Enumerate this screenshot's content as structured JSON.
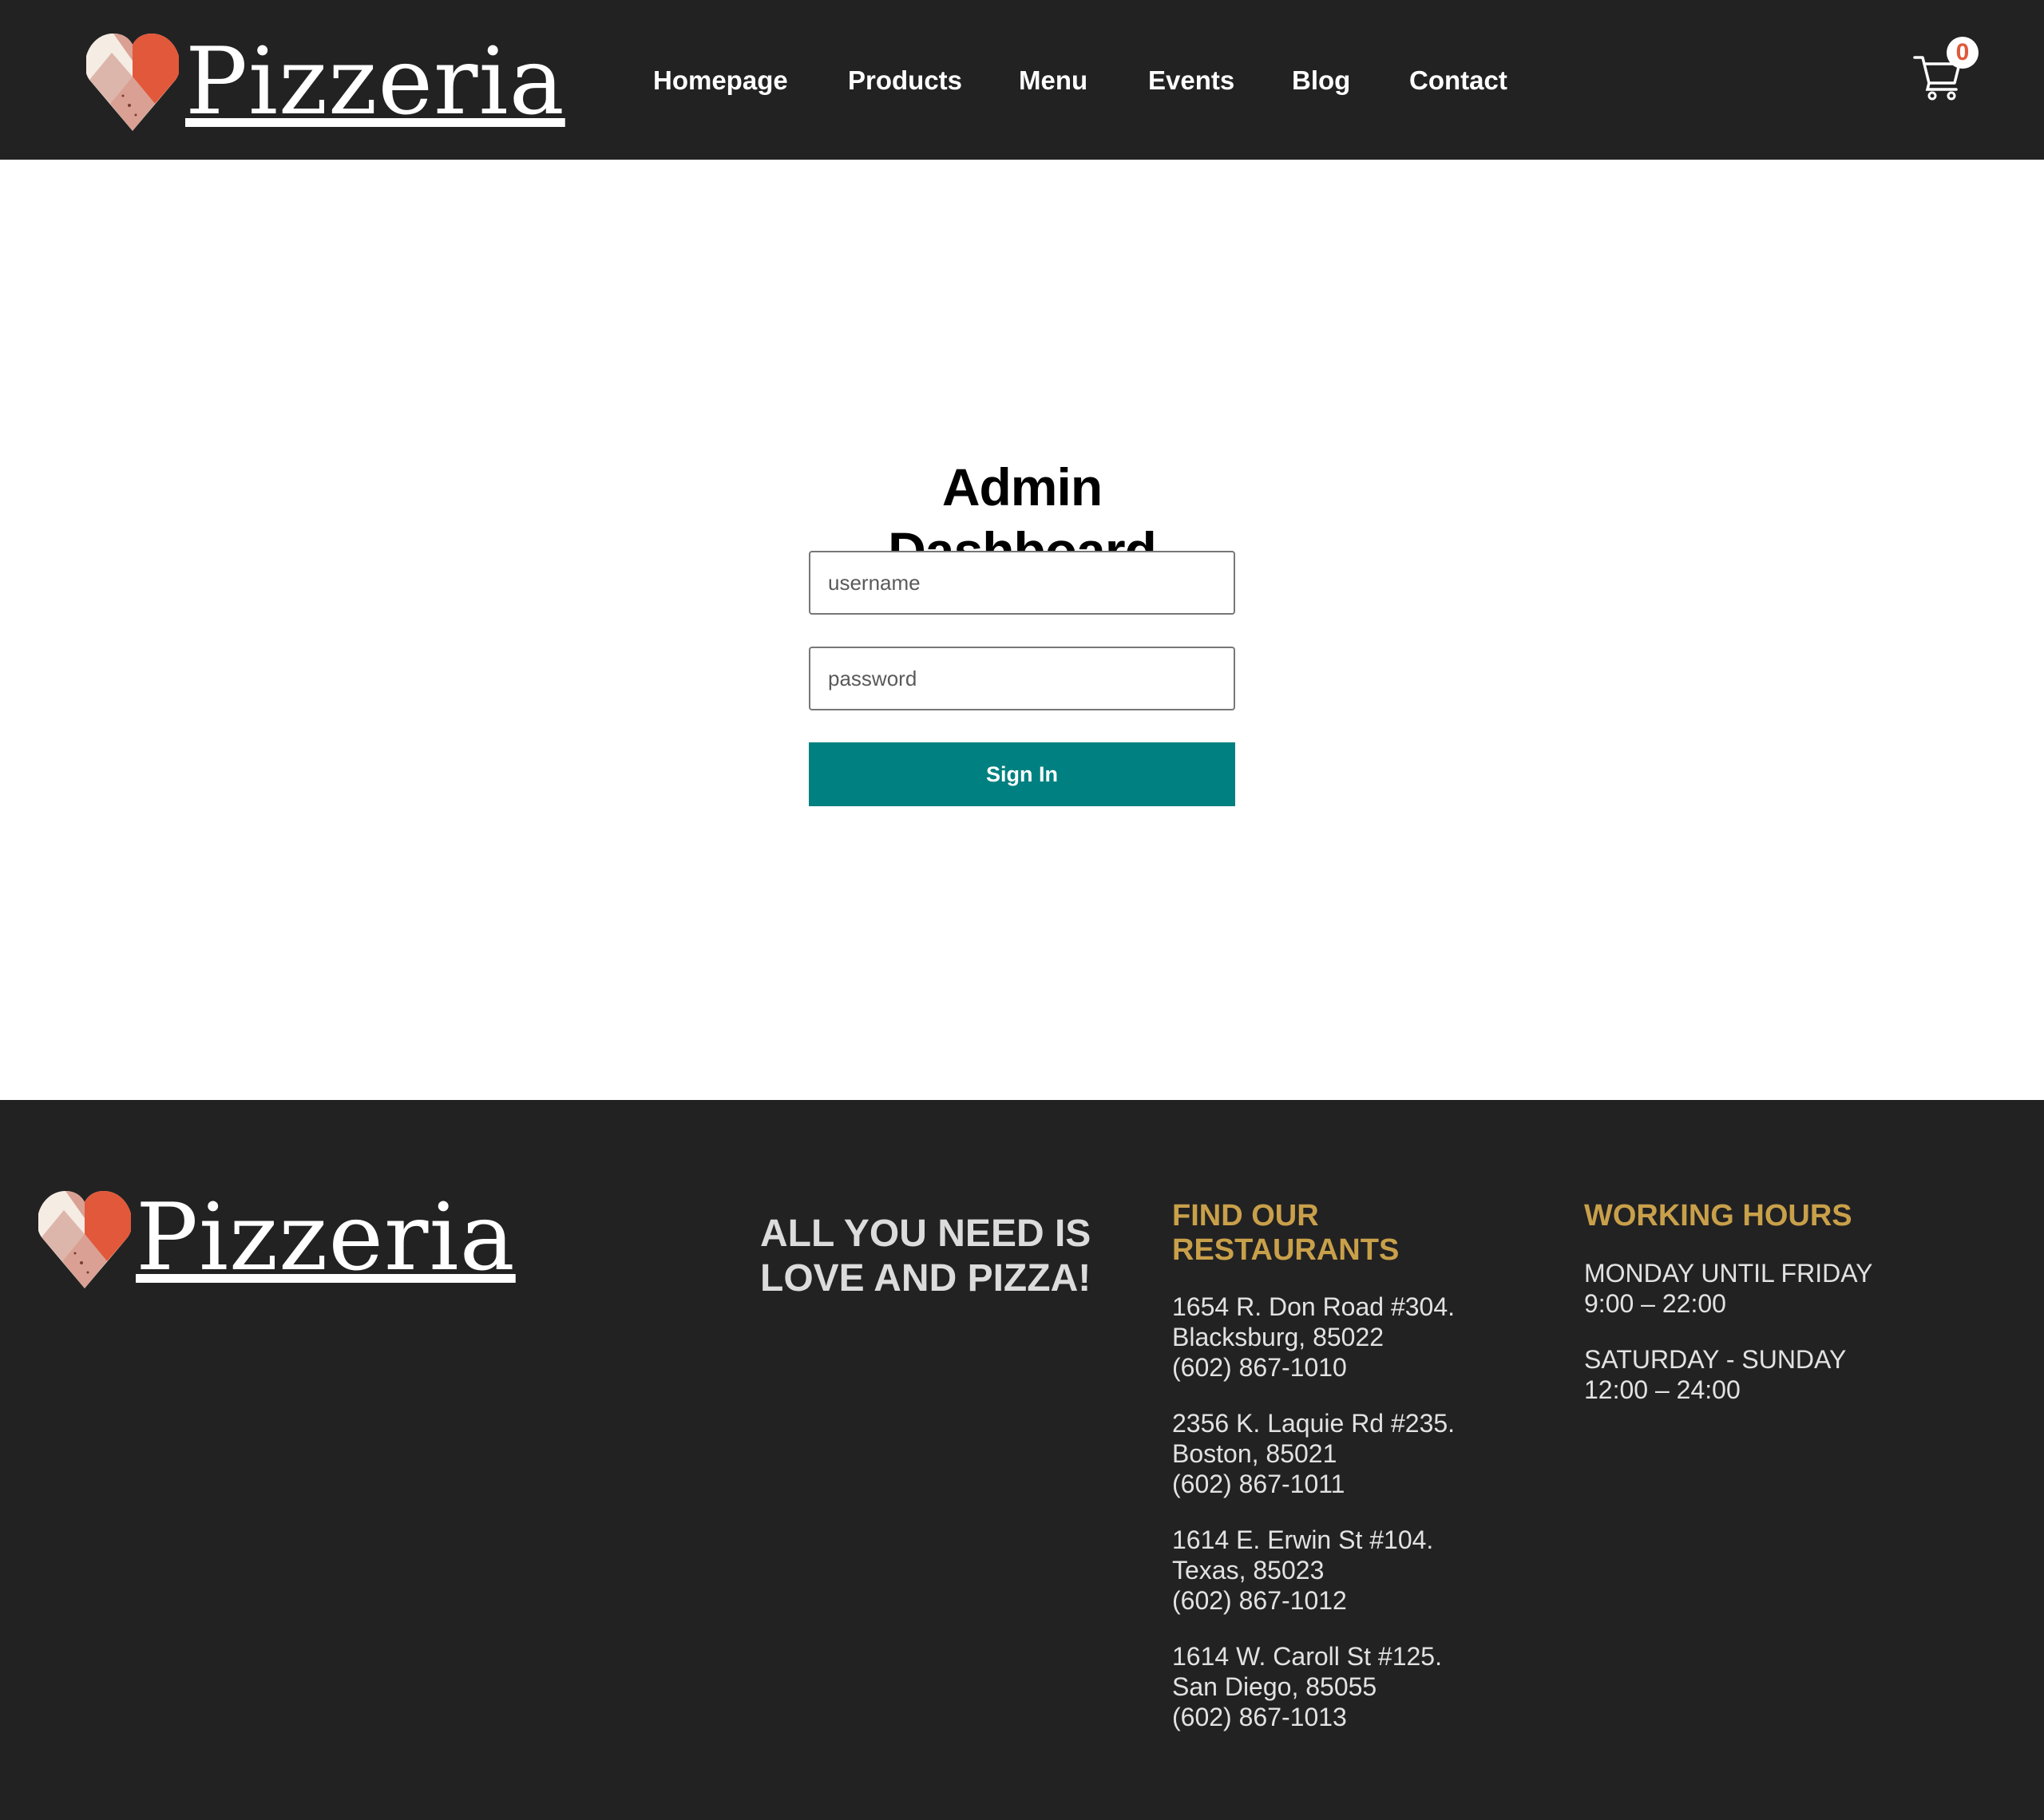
{
  "brand": {
    "name": "Pizzeria",
    "heart_colors": [
      "#e2583a",
      "#d9a093",
      "#f5ece3",
      "#c98a7d"
    ]
  },
  "nav": {
    "items": [
      {
        "label": "Homepage"
      },
      {
        "label": "Products"
      },
      {
        "label": "Menu"
      },
      {
        "label": "Events"
      },
      {
        "label": "Blog"
      },
      {
        "label": "Contact"
      }
    ]
  },
  "cart": {
    "icon": "cart-icon",
    "count": "0"
  },
  "login": {
    "title": "Admin Dashboard",
    "username_placeholder": "username",
    "password_placeholder": "password",
    "signin_label": "Sign In",
    "button_color": "#008080"
  },
  "footer": {
    "slogan_line1": "ALL YOU NEED IS",
    "slogan_line2": "LOVE AND PIZZA!",
    "restaurants_heading_line1": "FIND OUR",
    "restaurants_heading_line2": "RESTAURANTS",
    "restaurants": [
      {
        "address": "1654 R. Don Road #304.",
        "city": "Blacksburg, 85022",
        "phone": "(602) 867-1010"
      },
      {
        "address": "2356 K. Laquie Rd #235.",
        "city": "Boston, 85021",
        "phone": "(602) 867-1011"
      },
      {
        "address": "1614 E. Erwin St #104.",
        "city": "Texas, 85023",
        "phone": "(602) 867-1012"
      },
      {
        "address": "1614 W. Caroll St #125.",
        "city": "San Diego, 85055",
        "phone": "(602) 867-1013"
      }
    ],
    "hours_heading": "WORKING HOURS",
    "hours": [
      {
        "days": "MONDAY UNTIL FRIDAY",
        "time": "9:00 – 22:00"
      },
      {
        "days": "SATURDAY - SUNDAY",
        "time": "12:00 – 24:00"
      }
    ],
    "accent_color": "#c9a04a"
  }
}
